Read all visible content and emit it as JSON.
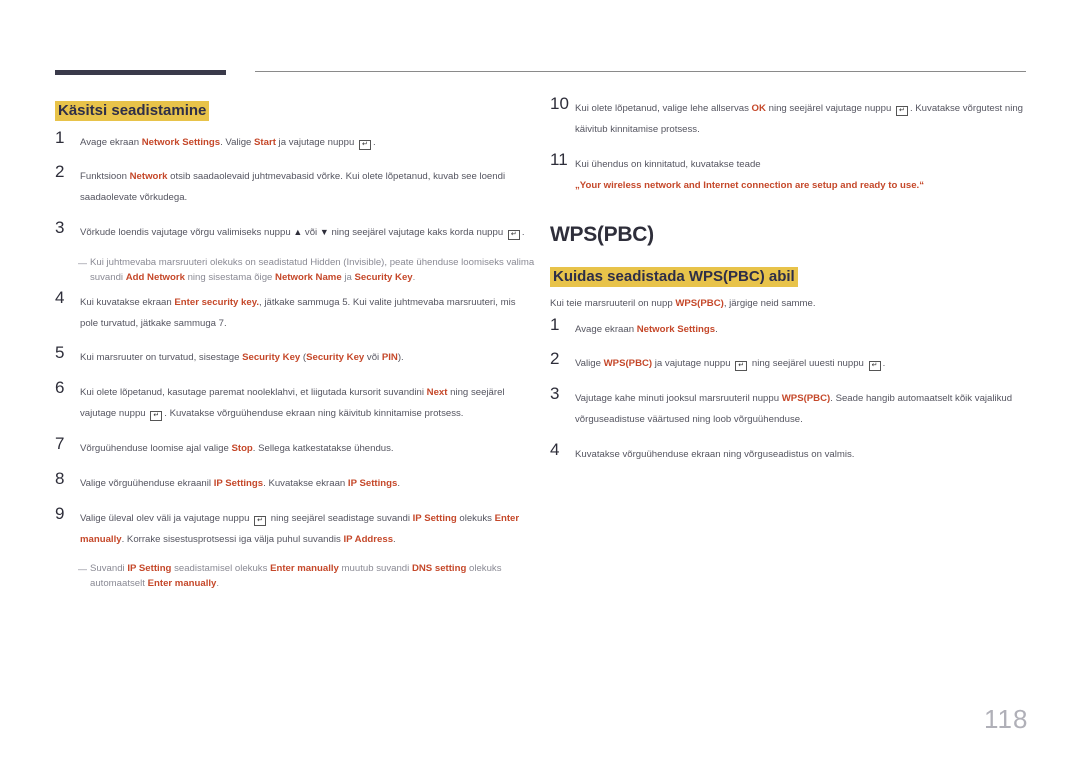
{
  "page_number": "118",
  "left": {
    "heading": "Käsitsi seadistamine",
    "steps": [
      {
        "n": "1",
        "parts": [
          "Avage ekraan ",
          "Network Settings",
          ". Valige ",
          "Start",
          " ja vajutage nuppu ",
          "."
        ]
      },
      {
        "n": "2",
        "parts": [
          "Funktsioon ",
          "Network",
          " otsib saadaolevaid juhtmevabasid võrke. Kui olete lõpetanud, kuvab see loendi saadaolevate võrkudega."
        ]
      },
      {
        "n": "3",
        "parts": [
          "Võrkude loendis vajutage võrgu valimiseks nuppu ",
          "▲",
          " või ",
          "▼",
          " ning seejärel vajutage kaks korda nuppu ",
          "."
        ]
      },
      {
        "n": "4",
        "parts": [
          "Kui kuvatakse ekraan ",
          "Enter security key.",
          ", jätkake sammuga 5. Kui valite juhtmevaba marsruuteri, mis pole turvatud, jätkake sammuga 7."
        ]
      },
      {
        "n": "5",
        "parts": [
          "Kui marsruuter on turvatud, sisestage ",
          "Security Key",
          " (",
          "Security Key",
          " või ",
          "PIN",
          ")."
        ]
      },
      {
        "n": "6",
        "parts": [
          "Kui olete lõpetanud, kasutage paremat nooleklahvi, et liigutada kursorit suvandini ",
          "Next",
          " ning seejärel vajutage nuppu ",
          ". Kuvatakse võrguühenduse ekraan ning käivitub kinnitamise protsess."
        ]
      },
      {
        "n": "7",
        "parts": [
          "Võrguühenduse loomise ajal valige ",
          "Stop",
          ". Sellega katkestatakse ühendus."
        ]
      },
      {
        "n": "8",
        "parts": [
          "Valige võrguühenduse ekraanil ",
          "IP Settings",
          ". Kuvatakse ekraan ",
          "IP Settings",
          "."
        ]
      },
      {
        "n": "9",
        "parts": [
          "Valige üleval olev väli ja vajutage nuppu ",
          " ning seejärel seadistage suvandi ",
          "IP Setting",
          " olekuks ",
          "Enter manually",
          ". Korrake sisestusprotsessi iga välja puhul suvandis ",
          "IP Address",
          "."
        ]
      }
    ],
    "note1": {
      "parts": [
        "Kui juhtmevaba marsruuteri olekuks on seadistatud Hidden (Invisible), peate ühenduse loomiseks valima suvandi ",
        "Add Network",
        " ning sisestama õige ",
        "Network Name",
        " ja ",
        "Security Key",
        "."
      ]
    },
    "note2": {
      "parts": [
        "Suvandi ",
        "IP Setting",
        " seadistamisel olekuks ",
        "Enter manually",
        " muutub suvandi ",
        "DNS setting",
        " olekuks automaatselt ",
        "Enter manually",
        "."
      ]
    }
  },
  "right": {
    "steps_cont": [
      {
        "n": "10",
        "parts": [
          "Kui olete lõpetanud, valige lehe allservas ",
          "OK",
          " ning seejärel vajutage nuppu ",
          ". Kuvatakse võrgutest ning käivitub kinnitamise protsess."
        ]
      },
      {
        "n": "11",
        "parts": [
          "Kui ühendus on kinnitatud, kuvatakse teade",
          "„Your wireless network and Internet connection are setup and ready to use.“"
        ]
      }
    ],
    "title": "WPS(PBC)",
    "heading": "Kuidas seadistada WPS(PBC) abil",
    "intro": {
      "parts": [
        "Kui teie marsruuteril on nupp ",
        "WPS(PBC)",
        ", järgige neid samme."
      ]
    },
    "steps": [
      {
        "n": "1",
        "parts": [
          "Avage ekraan ",
          "Network Settings",
          "."
        ]
      },
      {
        "n": "2",
        "parts": [
          "Valige ",
          "WPS(PBC)",
          " ja vajutage nuppu ",
          " ning seejärel uuesti nuppu ",
          "."
        ]
      },
      {
        "n": "3",
        "parts": [
          "Vajutage kahe minuti jooksul marsruuteril nuppu ",
          "WPS(PBC)",
          ". Seade hangib automaatselt kõik vajalikud võrguseadistuse väärtused ning loob võrguühenduse."
        ]
      },
      {
        "n": "4",
        "parts": [
          "Kuvatakse võrguühenduse ekraan ning võrguseadistus on valmis."
        ]
      }
    ]
  },
  "icons": {
    "enter": "enter-key-icon",
    "up": "up-arrow-icon",
    "down": "down-arrow-icon"
  },
  "colors": {
    "highlight": "#c5482a",
    "heading_bg": "#e8c34a",
    "heading_text": "#2e2e48"
  }
}
